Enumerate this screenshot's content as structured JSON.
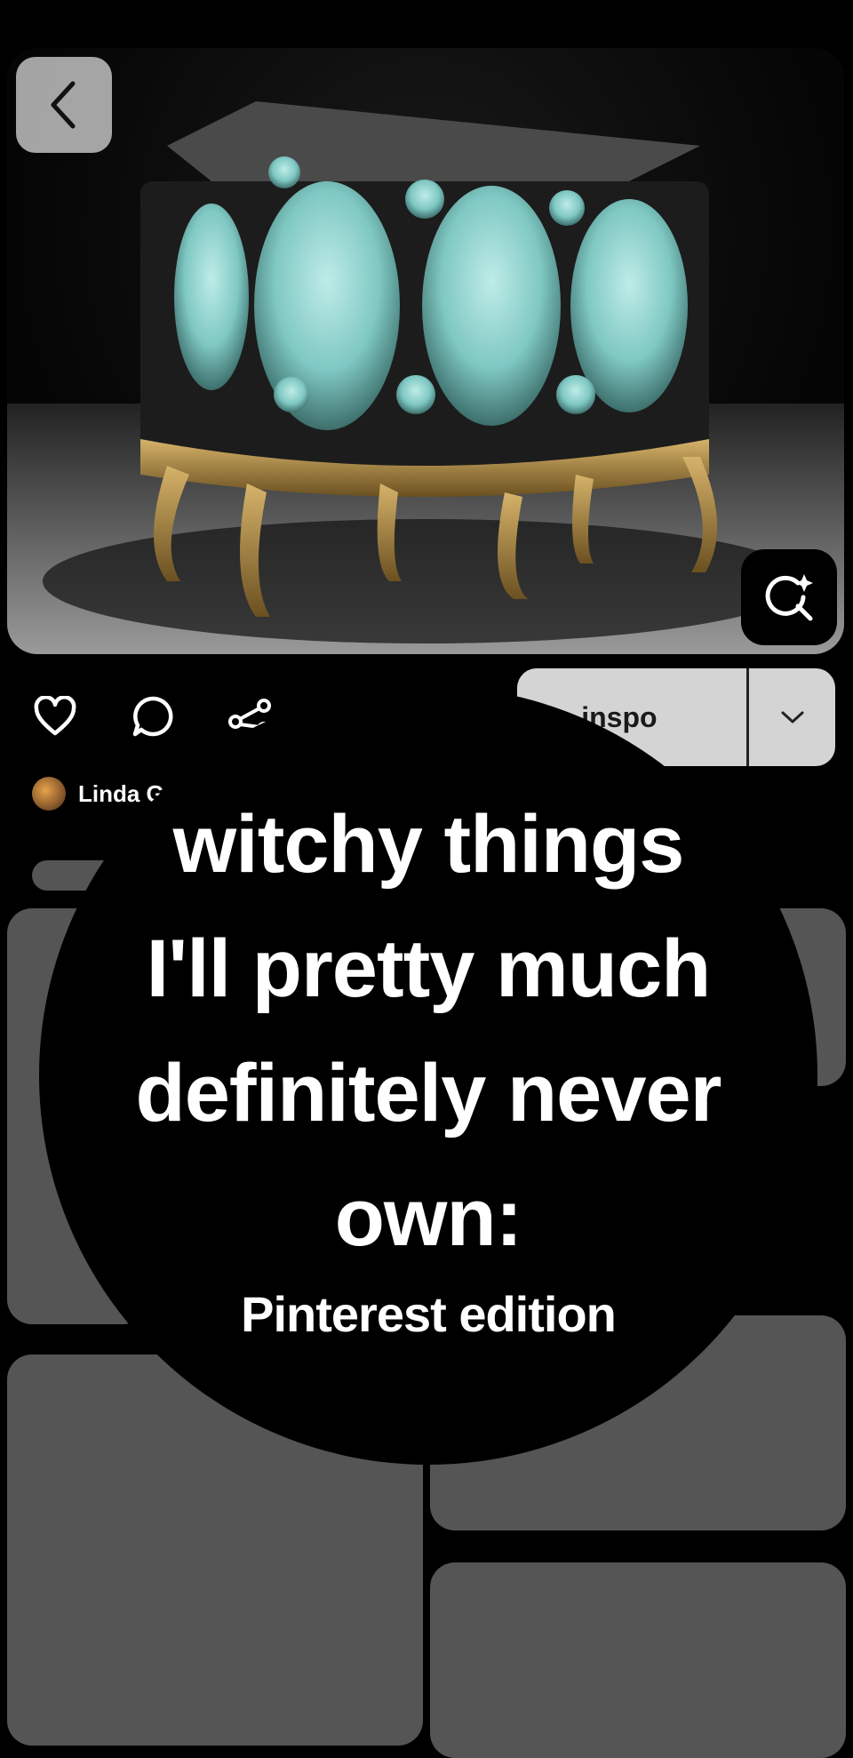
{
  "pin": {
    "board_label": "ko inspo",
    "author_name": "Linda G"
  },
  "overlay": {
    "title_lines": [
      "witchy things",
      "I'll pretty much",
      "definitely never",
      "own:"
    ],
    "subtitle": "Pinterest edition"
  },
  "icons": {
    "back": "chevron-left-icon",
    "visual_search": "lens-sparkle-icon",
    "like": "heart-icon",
    "comment": "comment-icon",
    "share": "share-icon",
    "board_dropdown": "chevron-down-icon"
  },
  "colors": {
    "background": "#000000",
    "placeholder_card": "#555555",
    "board_pill": "#d4d4d4",
    "mirror_glass": "#8fd3cf",
    "gold_trim": "#b08a3c"
  }
}
